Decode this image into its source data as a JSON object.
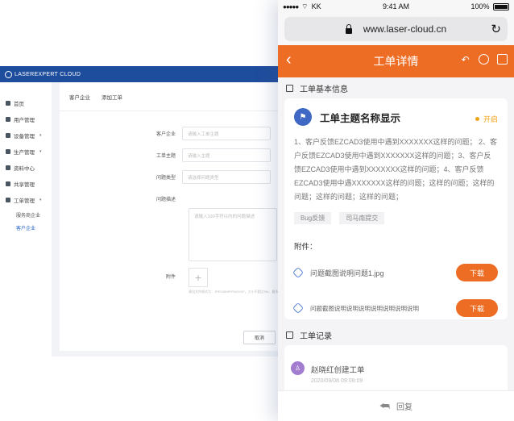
{
  "desktop": {
    "logo": "LASEREXPERT CLOUD",
    "sidebar": [
      {
        "label": "首页",
        "expandable": false
      },
      {
        "label": "用户管理",
        "expandable": false
      },
      {
        "label": "设备管理",
        "expandable": true
      },
      {
        "label": "生产管理",
        "expandable": true
      },
      {
        "label": "资料中心",
        "expandable": false
      },
      {
        "label": "共享管理",
        "expandable": false
      },
      {
        "label": "工单管理",
        "expandable": true
      }
    ],
    "sidebar_sub": [
      "服务商企业",
      "客户企业"
    ],
    "breadcrumb": [
      "客户企业",
      "添加工单"
    ],
    "form": {
      "company_label": "客户企业",
      "company_placeholder": "请输入工单主题",
      "subject_label": "工单主题",
      "subject_placeholder": "请输入主题",
      "type_label": "问题类型",
      "type_placeholder": "请选择问题类型",
      "desc_label": "问题描述",
      "desc_placeholder": "请输入100字符以内的问题描述",
      "attach_label": "附件",
      "attach_hint": "建议文件格式为：JPEG/BMP/PNG/GIF，大小不超过5M，最多上传5张",
      "cancel": "取消"
    }
  },
  "phone": {
    "status": {
      "carrier": "KK",
      "time": "9:41 AM",
      "battery": "100%"
    },
    "url": "www.laser-cloud.cn",
    "nav_title": "工单详情",
    "section_info": "工单基本信息",
    "ticket": {
      "title": "工单主题名称显示",
      "status": "开启",
      "description": "1、客户反馈EZCAD3使用中遇到XXXXXXX这样的问题； 2、客户反馈EZCAD3使用中遇到XXXXXXX这样的问题；3、客户反馈EZCAD3使用中遇到XXXXXXX这样的问题；4、客户反馈EZCAD3使用中遇XXXXXXX这样的问题；这样的问题；这样的问题；这样的问题；这样的问题；",
      "tags": [
        "Bug反馈",
        "司马南提交"
      ]
    },
    "attach_title": "附件：",
    "attachments": [
      {
        "name": "问题截图说明问题1.jpg",
        "action": "下载"
      },
      {
        "name": "问题截图说明说明说明说明说明说明说明",
        "action": "下载"
      }
    ],
    "section_records": "工单记录",
    "record": {
      "text": "赵晓红创建工单",
      "time": "2020/09/08 09:09:09"
    },
    "reply": "回复"
  }
}
